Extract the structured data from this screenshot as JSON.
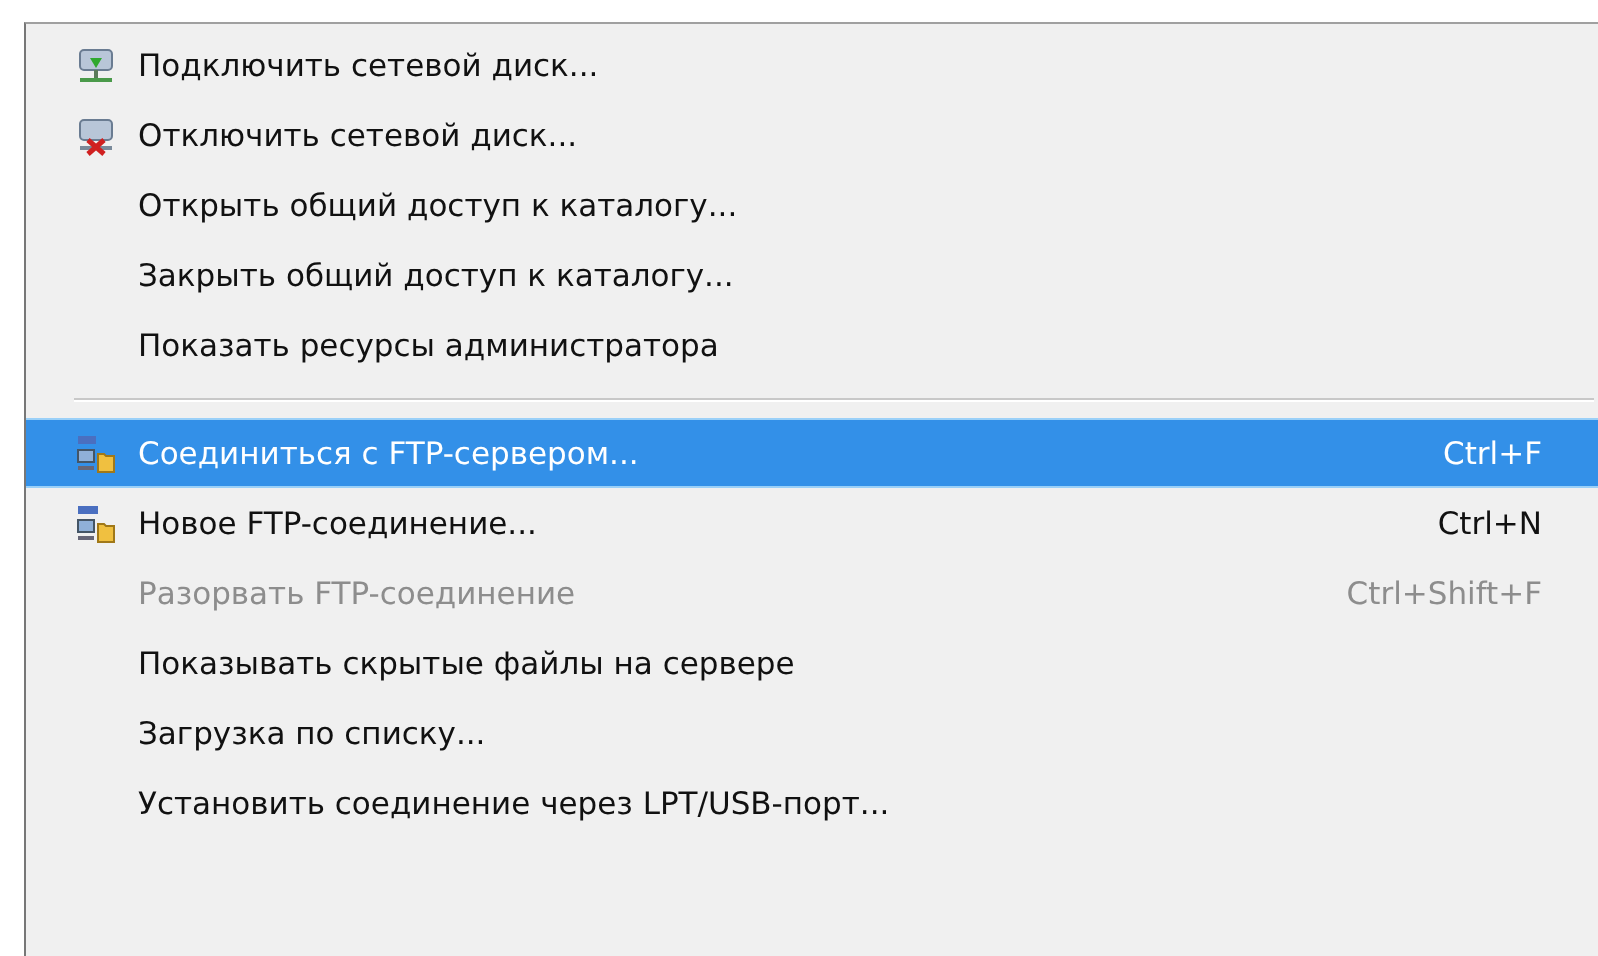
{
  "menu": {
    "items": [
      {
        "kind": "item",
        "label": "Подключить сетевой диск...",
        "selected": false,
        "disabled": false
      },
      {
        "kind": "item",
        "label": "Отключить сетевой диск...",
        "selected": false,
        "disabled": false
      },
      {
        "kind": "item",
        "label": "Открыть общий доступ к каталогу...",
        "selected": false,
        "disabled": false
      },
      {
        "kind": "item",
        "label": "Закрыть общий доступ к каталогу...",
        "selected": false,
        "disabled": false
      },
      {
        "kind": "item",
        "label": "Показать ресурсы администратора",
        "selected": false,
        "disabled": false
      },
      {
        "kind": "separator"
      },
      {
        "kind": "item",
        "label": "Соединиться с FTP-сервером...",
        "shortcut": "Ctrl+F",
        "selected": true,
        "disabled": false
      },
      {
        "kind": "item",
        "label": "Новое FTP-соединение...",
        "shortcut": "Ctrl+N",
        "selected": false,
        "disabled": false
      },
      {
        "kind": "item",
        "label": "Разорвать FTP-соединение",
        "shortcut": "Ctrl+Shift+F",
        "selected": false,
        "disabled": true
      },
      {
        "kind": "item",
        "label": "Показывать скрытые файлы на сервере",
        "selected": false,
        "disabled": false
      },
      {
        "kind": "item",
        "label": "Загрузка по списку...",
        "selected": false,
        "disabled": false
      },
      {
        "kind": "item",
        "label": "Установить соединение через LPT/USB-порт...",
        "selected": false,
        "disabled": false
      }
    ]
  }
}
